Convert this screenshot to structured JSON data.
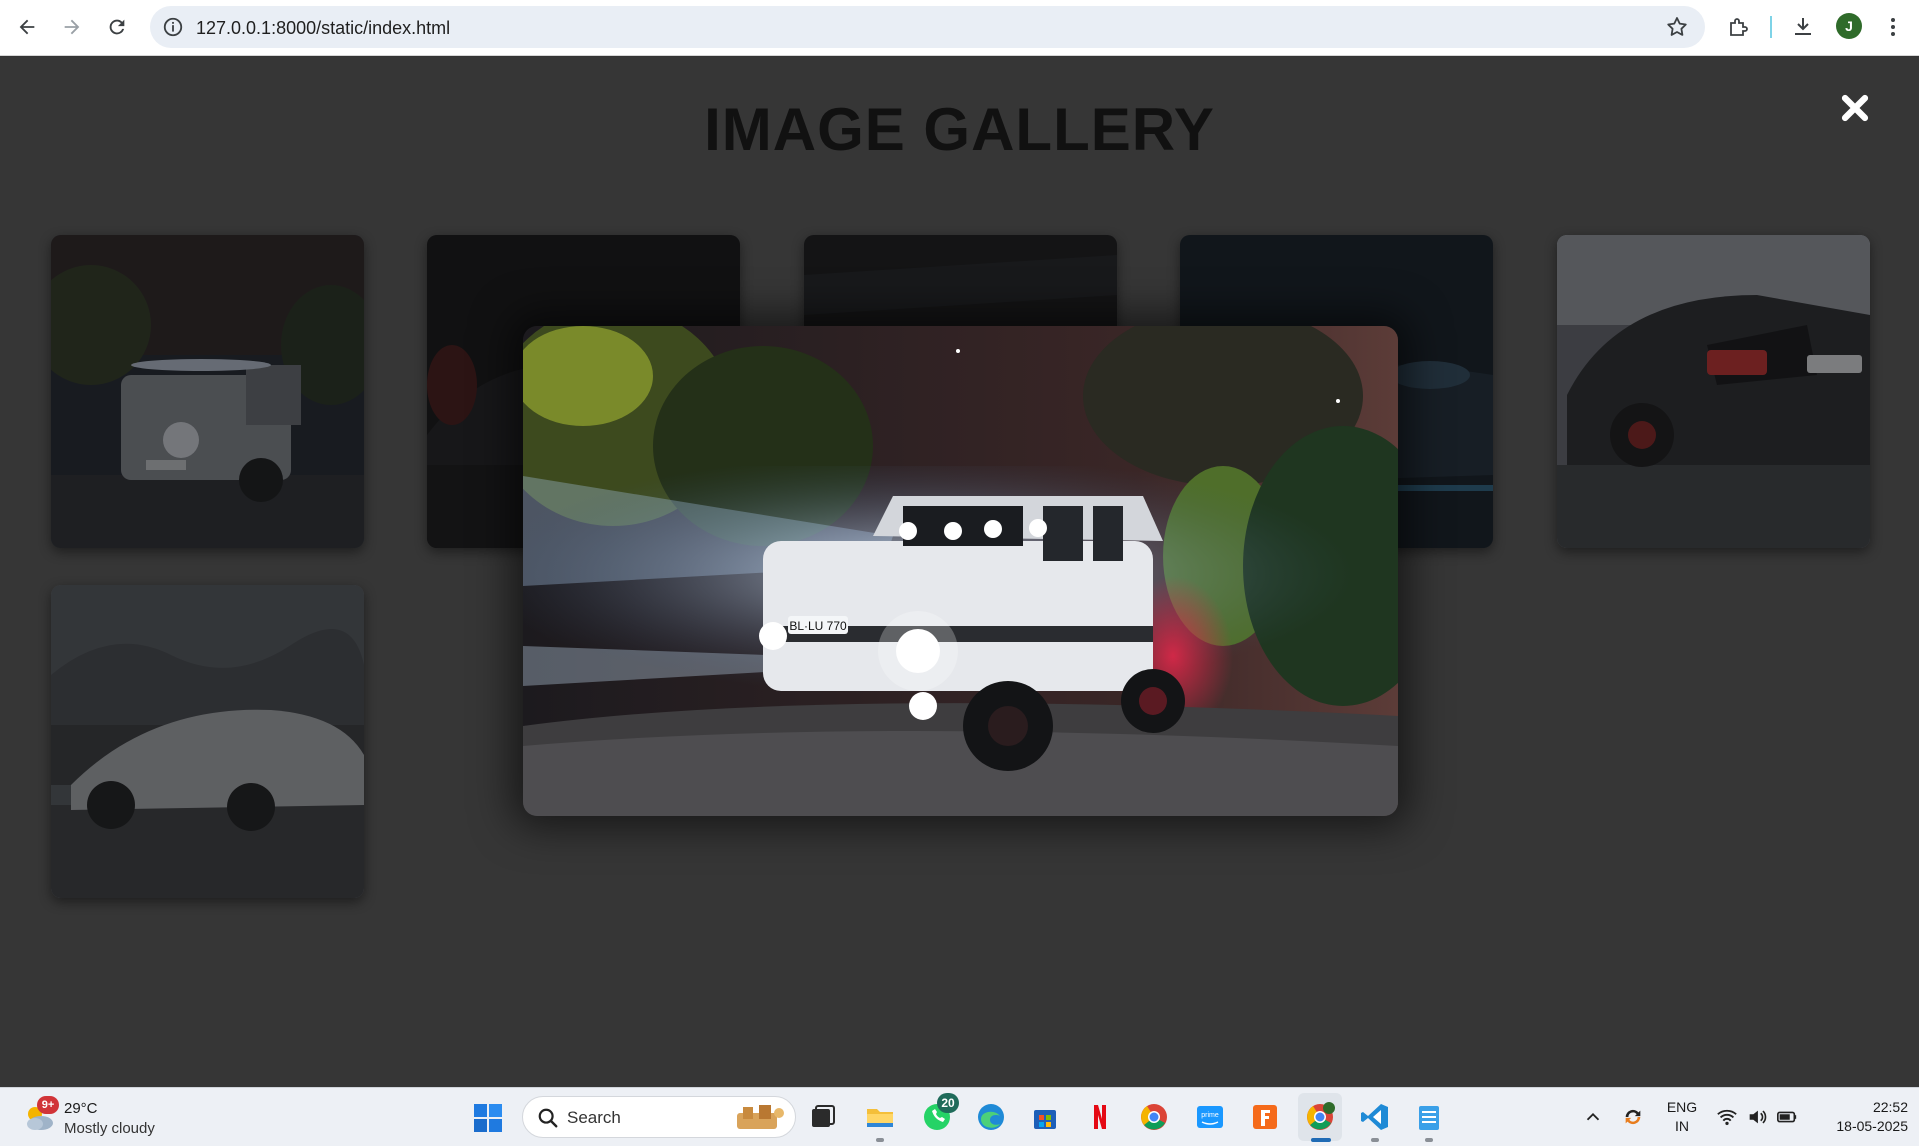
{
  "browser": {
    "url": "127.0.0.1:8000/static/index.html",
    "profile_initial": "J"
  },
  "page": {
    "title": "IMAGE GALLERY",
    "close_label": "✖"
  },
  "gallery": {
    "thumbnails": [
      {
        "name": "white-g-wagon-night",
        "dimmed": true
      },
      {
        "name": "dark-red-car",
        "dimmed": true
      },
      {
        "name": "dark-car-garage",
        "dimmed": true
      },
      {
        "name": "blue-lit-car",
        "dimmed": true
      },
      {
        "name": "black-mercedes-rear",
        "dimmed": true
      },
      {
        "name": "silver-supercar-palms",
        "dimmed": true
      }
    ],
    "lightbox": {
      "image_name": "white-g-wagon-night",
      "plate_text": "BL·LU 770"
    }
  },
  "taskbar": {
    "weather": {
      "temp": "29°C",
      "condition": "Mostly cloudy",
      "badge": "9+"
    },
    "search_placeholder": "Search",
    "whatsapp_badge": "20",
    "apps": [
      "task-view",
      "file-explorer",
      "whatsapp",
      "edge",
      "microsoft-store",
      "netflix",
      "chrome",
      "prime-video",
      "fiverr-app",
      "chrome-profile",
      "vscode",
      "notepad"
    ],
    "language": {
      "line1": "ENG",
      "line2": "IN"
    },
    "clock": {
      "time": "22:52",
      "date": "18-05-2025"
    }
  },
  "colors": {
    "page_bg": "#363636",
    "title": "#111111",
    "taskbar_bg": "#edf0f5"
  }
}
